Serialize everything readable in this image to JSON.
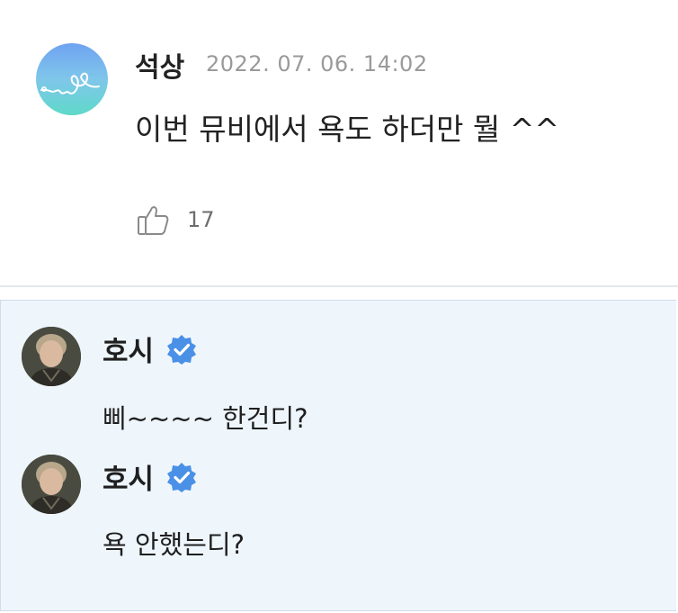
{
  "post": {
    "author": "석상",
    "date": "2022. 07. 06. 14:02",
    "text": "이번 뮤비에서 욕도 하더만 뭘 ^^",
    "likes": "17",
    "avatar_icon": "heart-doodle-avatar",
    "avatar_colors": [
      "#6fa3f2",
      "#5fd9c9"
    ]
  },
  "replies": [
    {
      "author": "호시",
      "verified_icon": "verified-badge-icon",
      "text": "삐~~~~ 한건디?"
    },
    {
      "author": "호시",
      "verified_icon": "verified-badge-icon",
      "text": "욕 안했는디?"
    }
  ],
  "colors": {
    "reply_background": "#eef6fc",
    "verified_badge": "#4a90e6",
    "date_text": "#9a9a9a"
  }
}
